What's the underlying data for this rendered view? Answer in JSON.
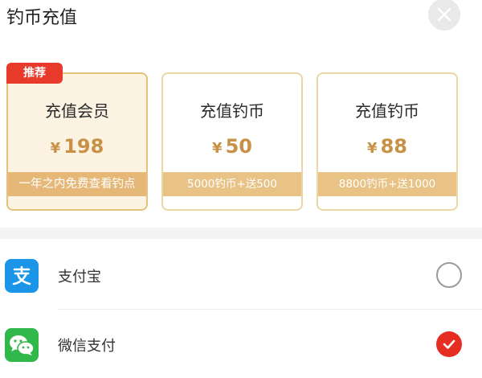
{
  "header": {
    "title": "钓币充值",
    "close_icon": "close-icon"
  },
  "badge": "推荐",
  "cards": [
    {
      "name": "充值会员",
      "currency": "¥",
      "price": "198",
      "bar_text": "一年之内免费查看钓点"
    },
    {
      "name": "充值钓币",
      "currency": "¥",
      "price": "50",
      "bar_text": "5000钓币+送500"
    },
    {
      "name": "充值钓币",
      "currency": "¥",
      "price": "88",
      "bar_text": "8800钓币+送1000"
    }
  ],
  "payments": [
    {
      "label": "支付宝",
      "icon": "alipay-icon",
      "selected": false
    },
    {
      "label": "微信支付",
      "icon": "wechat-icon",
      "selected": true
    }
  ],
  "colors": {
    "accent_red": "#e52d22",
    "gold": "#c79245",
    "bar": "#e9c386",
    "alipay": "#1a95e8",
    "wechat": "#30b84a"
  }
}
